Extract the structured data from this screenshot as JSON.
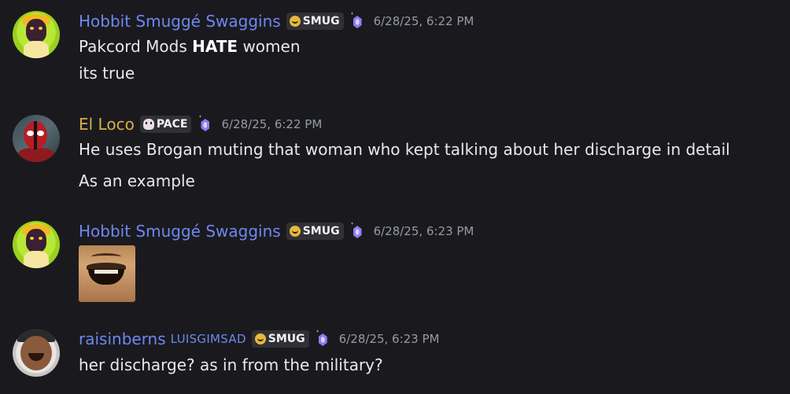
{
  "messages": [
    {
      "username": "Hobbit Smuggé Swaggins",
      "username_color": "#6d88f0",
      "tag": {
        "icon": "smug-face-icon",
        "label": "SMUG"
      },
      "badge_icon": "server-boost-gem-icon",
      "timestamp": "6/28/25, 6:22 PM",
      "lines": [
        {
          "pre": "Pakcord Mods ",
          "bold": "HATE",
          "post": " women"
        },
        {
          "text": "its true"
        }
      ]
    },
    {
      "username": "El Loco",
      "username_color": "#d9ad4b",
      "tag": {
        "icon": "skull-icon",
        "label": "PACE"
      },
      "badge_icon": "server-boost-gem-icon",
      "timestamp": "6/28/25, 6:22 PM",
      "lines": [
        {
          "text": "He uses Brogan muting that woman who kept talking about her discharge in detail"
        },
        {
          "text": "As an example"
        }
      ]
    },
    {
      "username": "Hobbit Smuggé Swaggins",
      "username_color": "#6d88f0",
      "tag": {
        "icon": "smug-face-icon",
        "label": "SMUG"
      },
      "badge_icon": "server-boost-gem-icon",
      "timestamp": "6/28/25, 6:23 PM",
      "attachment": "laughing-man-emoji-image"
    },
    {
      "username": "raisinberns",
      "username_color": "#6d88f0",
      "subname": "LUISGIMSAD",
      "tag": {
        "icon": "smug-face-icon",
        "label": "SMUG"
      },
      "badge_icon": "server-boost-gem-icon",
      "timestamp": "6/28/25, 6:23 PM",
      "lines": [
        {
          "text": "her discharge? as in from the military?"
        }
      ]
    }
  ]
}
